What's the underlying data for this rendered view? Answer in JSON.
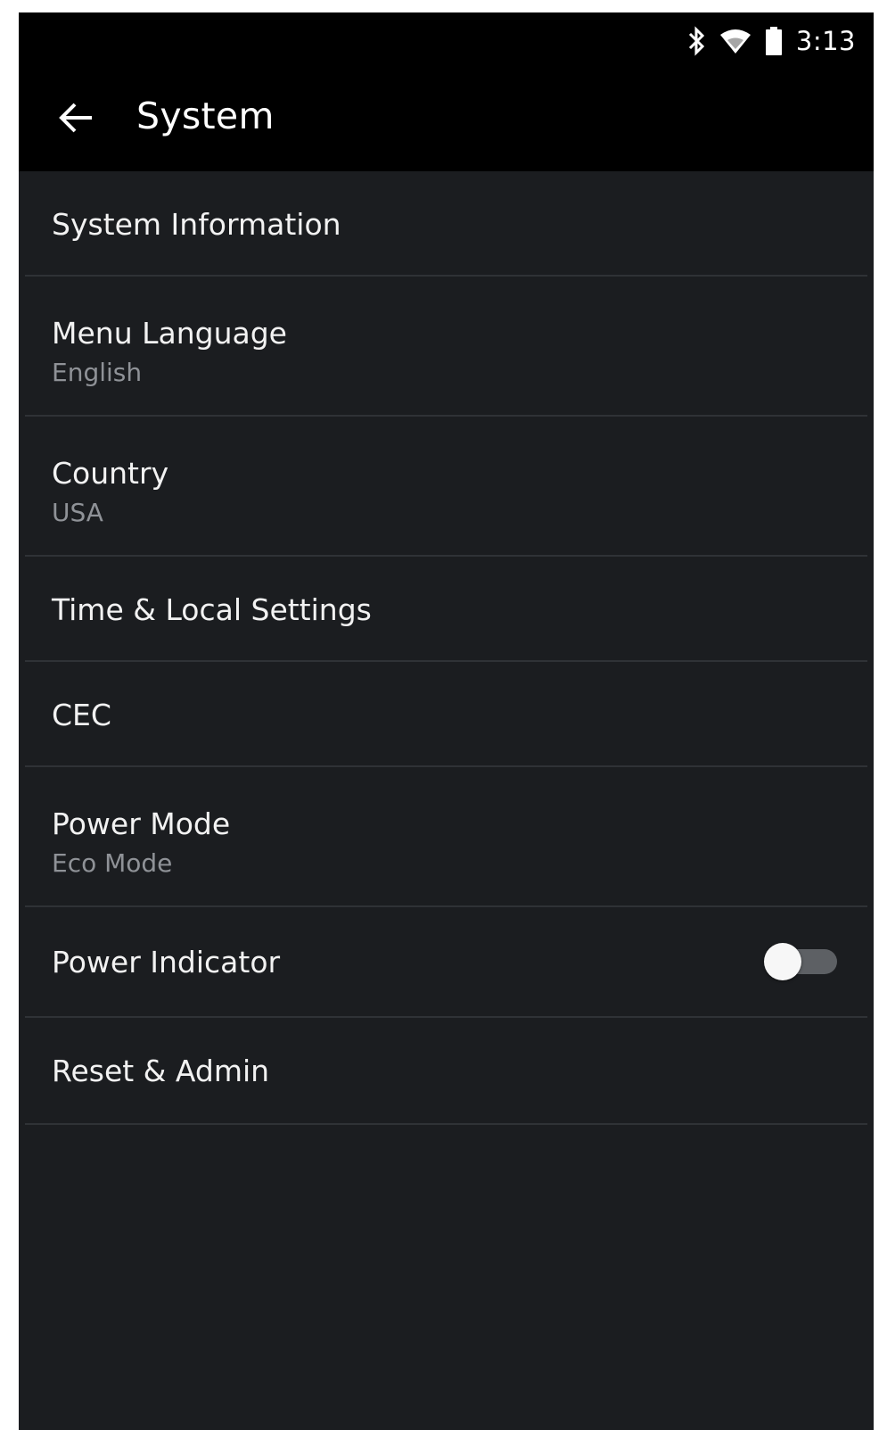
{
  "status_bar": {
    "time": "3:13",
    "icons": [
      "bluetooth-icon",
      "wifi-icon",
      "battery-icon"
    ]
  },
  "app_bar": {
    "title": "System",
    "back_icon": "arrow-left-icon"
  },
  "menu": {
    "items": [
      {
        "label": "System Information"
      },
      {
        "label": "Menu Language",
        "value": "English"
      },
      {
        "label": "Country",
        "value": "USA"
      },
      {
        "label": "Time & Local Settings"
      },
      {
        "label": "CEC"
      },
      {
        "label": "Power Mode",
        "value": "Eco Mode"
      },
      {
        "label": "Power Indicator",
        "toggle_on": false
      },
      {
        "label": "Reset & Admin"
      }
    ]
  },
  "colors": {
    "background": "#1b1d20",
    "header": "#000000",
    "text_primary": "#f2f2f2",
    "text_secondary": "#8f9297",
    "divider": "#2f3236"
  }
}
